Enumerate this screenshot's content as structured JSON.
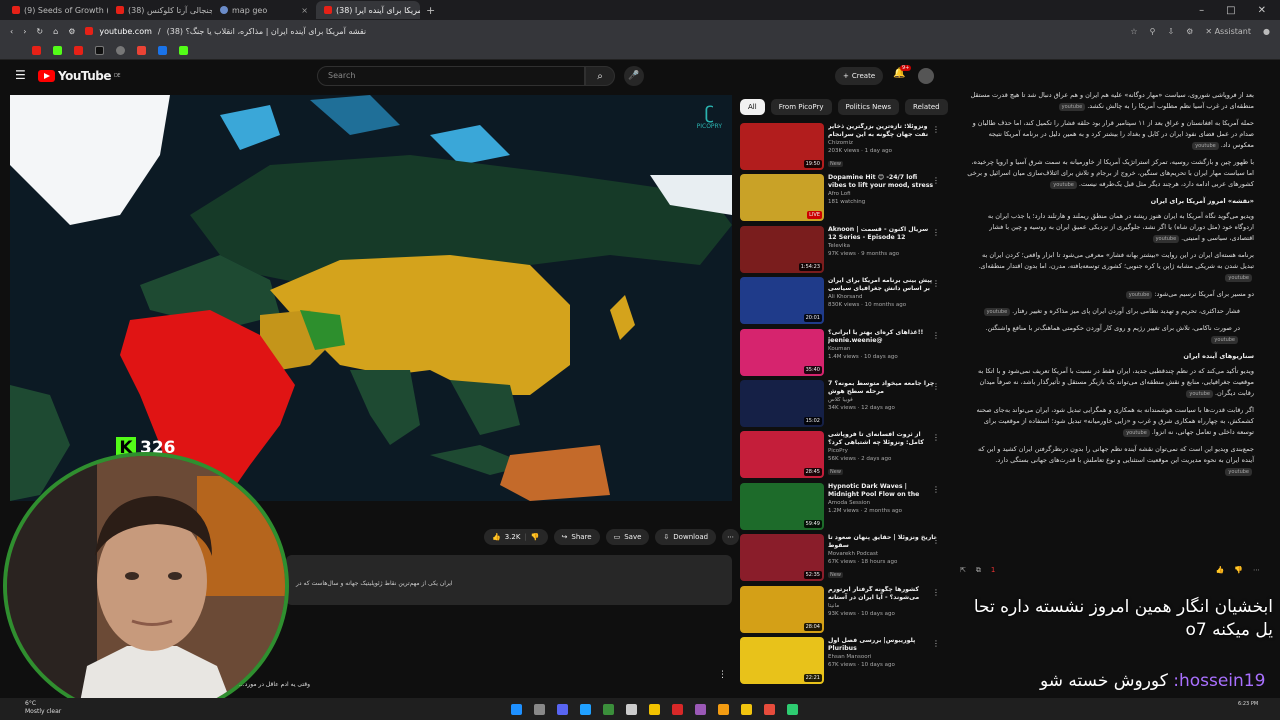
{
  "browser": {
    "tabs": [
      "(9) Seeds of Growth (1111hz)",
      "(38) دیدار جنجالی آرتا کلوکنس",
      "map geo",
      "(38) نقشه آمریکا برای آینده ایرا"
    ],
    "active_tab_index": 3,
    "url_domain": "youtube.com",
    "url_title": "نقشه آمریکا برای آینده ایران | مذاکره، انقلاب یا جنگ؟ (38)",
    "assistant_label": "Assistant",
    "window_controls": [
      "–",
      "□",
      "✕"
    ]
  },
  "youtube": {
    "logo_text": "YouTube",
    "logo_sup": "DE",
    "search_placeholder": "Search",
    "create_label": "Create",
    "notif_count": "9+",
    "video_watermark": "PICOPRY",
    "actions": {
      "likes": "3.2K",
      "share": "Share",
      "save": "Save",
      "download": "Download"
    },
    "description": "ایران یکی از مهم‌ترین نقاط ژئوپلیتیک جهانه و سال‌هاست که در",
    "comment_text": "وقتی یه ادم عاقل در مورد...",
    "chips": [
      "All",
      "From PicoPry",
      "Politics News",
      "Related"
    ],
    "sidebar": [
      {
        "title": "ونزوئلا: تازه‌ترین بزرگترین ذخایر نفت جهان چگونه به این سرانجام رسید؟",
        "channel": "Chizomiz",
        "meta": "203K views · 1 day ago",
        "badge": "New",
        "duration": "19:50",
        "color": "#b21d1d"
      },
      {
        "title": "Dopamine Hit 😊 -24/7 lofi vibes to lift your mood, stress ...",
        "channel": "Afro Lofi",
        "meta": "181 watching",
        "badge": "",
        "duration": "LIVE",
        "color": "#c9a227"
      },
      {
        "title": "Aknoon | سریال اکنون - قسمت 12 Series - Episode 12",
        "channel": "Televika",
        "meta": "97K views · 9 months ago",
        "badge": "",
        "duration": "1:54:23",
        "color": "#7a1d1d"
      },
      {
        "title": "پیش بینی برنامه آمریکا برای ایران بر اساس دانش جغرافیای سیاسی",
        "channel": "Ali Khorsand",
        "meta": "830K views · 10 months ago",
        "badge": "",
        "duration": "20:01",
        "color": "#1f3b8a"
      },
      {
        "title": "غذاهای کره‌ای بهتر یا ایرانی؟!! jeenie.weenie@",
        "channel": "Kouman",
        "meta": "1.4M views · 10 days ago",
        "badge": "",
        "duration": "35:40",
        "color": "#d6246e"
      },
      {
        "title": "چرا جامعه میخواد متوسط بمونه؟ 7 مرحله سطح هوش",
        "channel": "فوبیا کلاس",
        "meta": "34K views · 12 days ago",
        "badge": "",
        "duration": "15:02",
        "color": "#152046"
      },
      {
        "title": "از ثروت افسانه‌ای تا فروپاشی کامل: ونزوئلا چه اشتباهی کرد؟",
        "channel": "PicoPry",
        "meta": "56K views · 2 days ago",
        "badge": "New",
        "duration": "28:45",
        "color": "#c41e3a"
      },
      {
        "title": "Hypnotic Dark Waves | Midnight Pool Flow on the 20th Floor",
        "channel": "Amoda Session",
        "meta": "1.2M views · 2 months ago",
        "badge": "",
        "duration": "59:49",
        "color": "#1d6b2a"
      },
      {
        "title": "تاریخ ونزوئلا | حقایق پنهان صعود تا سقوط",
        "channel": "Movarekh Podcast",
        "meta": "67K views · 18 hours ago",
        "badge": "New",
        "duration": "52:35",
        "color": "#8a1d2a"
      },
      {
        "title": "کشورها چگونه گرفتار ابرتورم می‌شوند؟ - آیا ایران در آستانه یک...",
        "channel": "مانیتا",
        "meta": "93K views · 10 days ago",
        "badge": "",
        "duration": "28:04",
        "color": "#d4a017"
      },
      {
        "title": "پلوریبوس| بررسی فصل اول Pluribus",
        "channel": "Ehsan Mansoori",
        "meta": "67K views · 10 days ago",
        "badge": "",
        "duration": "22:21",
        "color": "#e8c21a"
      }
    ]
  },
  "assistant": {
    "paragraphs": [
      {
        "text": "بعد از فروپاشی شوروی، سیاست «مهار دوگانه» علیه هم ایران و هم عراق دنبال شد تا هیچ قدرت مستقل منطقه‌ای در غرب آسیا نظم مطلوب آمریکا را به چالش نکشد.",
        "sub": false
      },
      {
        "text": "حمله آمریکا به افغانستان و عراق بعد از ۱۱ سپتامبر قرار بود حلقه فشار را تکمیل کند، اما حذف طالبان و صدام در عمل فضای نفوذ ایران در کابل و بغداد را بیشتر کرد و به همین دلیل در برنامه آمریکا نتیجه معکوس داد.",
        "sub": false
      },
      {
        "text": "با ظهور چین و بازگشت روسیه، تمرکز استراتژیک آمریکا از خاورمیانه به سمت شرق آسیا و اروپا چرخیده، اما سیاست مهار ایران با تحریم‌های سنگین، خروج از برجام و تلاش برای ائتلاف‌سازی میان اسرائیل و برخی کشورهای عربی ادامه دارد، هرچند دیگر مثل قبل یک‌طرفه نیست.",
        "sub": false
      }
    ],
    "heading1": "«نقشه» امروز آمریکا برای ایران",
    "paragraphs2": [
      {
        "text": "ویدیو می‌گوید نگاه آمریکا به ایران هنوز ریشه در همان منطق ریملند و هارتلند دارد؛ یا جذب ایران به اردوگاه خود (مثل دوران شاه) یا اگر نشد، جلوگیری از نزدیکی عمیق ایران به روسیه و چین با فشار اقتصادی، سیاسی و امنیتی.",
        "sub": false
      },
      {
        "text": "برنامه هسته‌ای ایران در این روایت «بیشتر بهانه فشار» معرفی می‌شود تا ابزار واقعی؛ کردن ایران به تبدیل شدن به شریکی مشابه ژاپن یا کره جنوبی؛ کشوری توسعه‌یافته، مدرن، اما بدون اقتدار منطقه‌ای.",
        "sub": false
      },
      {
        "text": "دو مسیر برای آمریکا ترسیم می‌شود:",
        "sub": false
      },
      {
        "text": "فشار حداکثری، تحریم و تهدید نظامی برای آوردن ایران پای میز مذاکره و تغییر رفتار.",
        "sub": true
      },
      {
        "text": "در صورت ناکامی، تلاش برای تغییر رژیم و روی کار آوردن حکومتی هماهنگ‌تر با منافع واشنگتن.",
        "sub": true
      }
    ],
    "heading2": "سناریوهای آینده ایران",
    "paragraphs3": [
      {
        "text": "ویدیو تأکید می‌کند که در نظم چندقطبی جدید، ایران فقط در نسبت با آمریکا تعریف نمی‌شود و با اتکا به موقعیت جغرافیایی، منابع و نقش منطقه‌ای می‌تواند یک بازیگر مستقل و تأثیرگذار باشد، نه صرفاً میدان رقابت دیگران.",
        "sub": false
      },
      {
        "text": "اگر رقابت قدرت‌ها با سیاست هوشمندانه به همکاری و همگرایی تبدیل شود، ایران می‌تواند به‌جای صحنه کشمکش، به چهارراه همکاری شرق و غرب و «زایی خاورمیانه» تبدیل شود؛ استفاده از موقعیت برای توسعه داخلی و تعامل جهانی، نه انزوا.",
        "sub": false
      },
      {
        "text": "جمع‌بندی ویدیو این است که نمی‌توان نقشه آینده نظم جهانی را بدون درنظرگرفتن ایران کشید و این که آینده ایران به نحوه مدیریت این موقعیت استثنایی و نوع تعاملش با قدرت‌های جهانی بستگی دارد.",
        "sub": false
      }
    ],
    "tag": "youtube",
    "action_badge": "1"
  },
  "overlay": {
    "kick_viewers": "326",
    "kick_letter": "K",
    "chat_line1": "ابخشیان انگار همین امروز نشسته داره تحا یل میکنه o7",
    "chat_user": "hossein19",
    "chat_line2": "کوروش خسته شو"
  },
  "taskbar": {
    "temp": "6°C",
    "weather": "Mostly clear",
    "clock": "6:23 PM"
  }
}
